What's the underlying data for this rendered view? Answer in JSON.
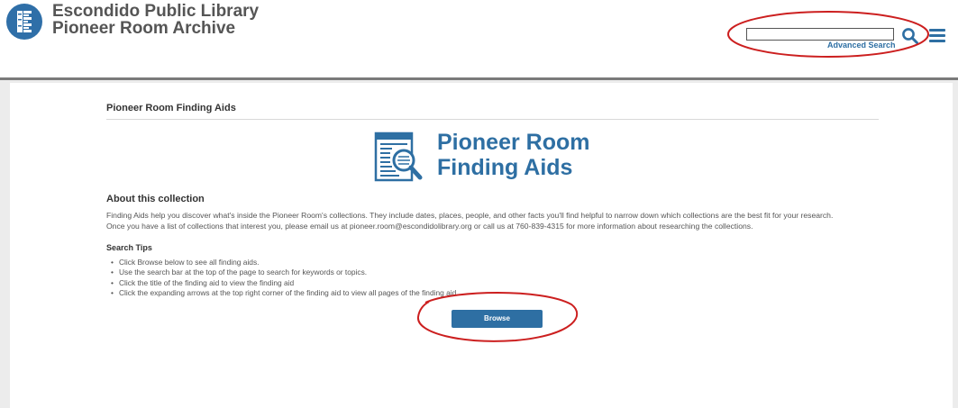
{
  "header": {
    "title_line1": "Escondido Public Library",
    "title_line2": "Pioneer Room Archive",
    "logo_icon": "library-e-logo-icon",
    "search": {
      "value": "",
      "placeholder": ""
    },
    "advanced_search_label": "Advanced Search",
    "search_icon": "magnifier-icon",
    "menu_icon": "hamburger-menu-icon"
  },
  "main": {
    "page_title": "Pioneer Room Finding Aids",
    "banner": {
      "line1": "Pioneer Room",
      "line2": "Finding Aids",
      "icon": "document-magnifier-icon"
    },
    "about": {
      "heading": "About this collection",
      "line1": "Finding Aids help you discover what's inside the Pioneer Room's collections. They include dates, places, people, and other facts you'll find helpful to narrow down which collections are the best fit for your research.",
      "line2": "Once you have a list of collections that interest you, please email us  at pioneer.room@escondidolibrary.org or call us at 760-839-4315 for more information about researching the collections."
    },
    "tips": {
      "heading": "Search Tips",
      "items": [
        "Click Browse below to see all finding aids.",
        "Use the search bar at the top of the page to search for keywords or topics.",
        "Click the title of the finding aid to view the finding aid",
        "Click the expanding arrows at the top right corner of the finding aid to view all pages of the finding aid."
      ]
    },
    "browse_label": "Browse"
  },
  "colors": {
    "brand_blue": "#2e6fa3",
    "annotation_red": "#cc1f1f",
    "frame_gray": "#ececec"
  }
}
